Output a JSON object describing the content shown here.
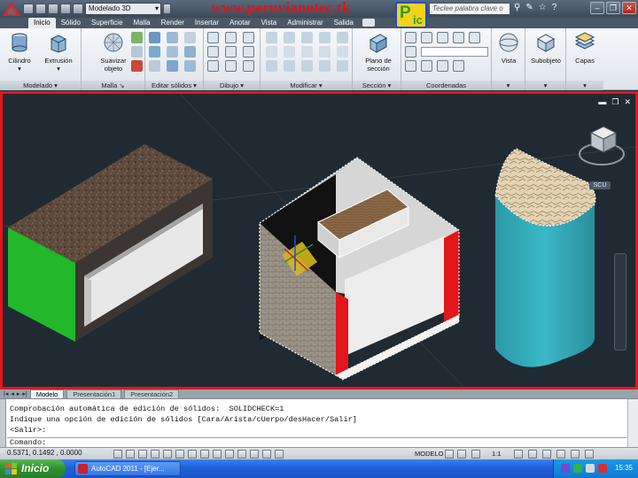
{
  "titlebar": {
    "workspace": "Modelado 3D",
    "watermark": "www.peruvianotec.tk",
    "search_placeholder": "Teclee palabra clave o frase"
  },
  "ribbon_tabs": [
    "Inicio",
    "Sólido",
    "Superficie",
    "Malla",
    "Render",
    "Insertar",
    "Anotar",
    "Vista",
    "Administrar",
    "Salida"
  ],
  "ribbon": {
    "panels": {
      "modelado": "Modelado",
      "malla": "Malla",
      "editar_solidos": "Editar sólidos",
      "dibujo": "Dibujo",
      "modificar": "Modificar",
      "seccion": "Sección",
      "coordenadas": "Coordenadas"
    },
    "buttons": {
      "cilindro": "Cilindro",
      "extrusion": "Extrusión",
      "suavizar_objeto": "Suavizar objeto",
      "plano_seccion": "Plano de sección",
      "vista": "Vista",
      "subobjeto": "Subobjeto",
      "capas": "Capas"
    }
  },
  "viewport": {
    "scu_label": "SCU"
  },
  "layout_tabs": [
    "Modelo",
    "Presentación1",
    "Presentación2"
  ],
  "command": {
    "lines": [
      "Comprobación automática de edición de sólidos:  SOLIDCHECK=1",
      "Indique una opción de edición de sólidos [Cara/Arista/cUerpo/desHacer/Salir]",
      "<Salir>:"
    ],
    "prompt": "Comando:"
  },
  "statusbar": {
    "coordinates": "0.5371, 0.1492 , 0.0000",
    "model_label": "MODELO",
    "scale": "1:1"
  },
  "taskbar": {
    "start_label": "Inicio",
    "app_label": "AutoCAD 2011 - [Ejer...",
    "language": "ES",
    "clock": "15:35"
  },
  "colors": {
    "frame_red": "#e3161b",
    "viewport_bg": "#1f2a33",
    "cylinder_teal": "#33a7b5",
    "box_green": "#22b82a",
    "ribbon_bg": "#e9eef3"
  }
}
